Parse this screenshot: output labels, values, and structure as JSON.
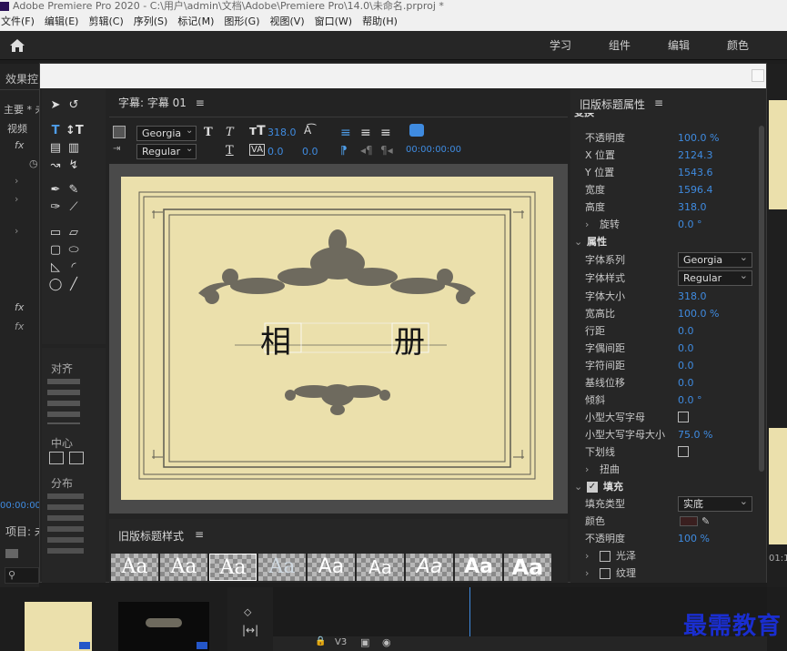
{
  "window_title": "Adobe Premiere Pro 2020 - C:\\用户\\admin\\文档\\Adobe\\Premiere Pro\\14.0\\未命名.prproj *",
  "menu": [
    "文件(F)",
    "编辑(E)",
    "剪辑(C)",
    "序列(S)",
    "标记(M)",
    "图形(G)",
    "视图(V)",
    "窗口(W)",
    "帮助(H)"
  ],
  "workspaces": [
    "学习",
    "组件",
    "编辑",
    "颜色"
  ],
  "left_panel": {
    "tab": "效果控",
    "main": "主要 * 未",
    "video": "视频",
    "project_tab": "项目: 未",
    "timecode": "00:00:00:0"
  },
  "dialog": {
    "title_tab": "字幕: 字幕 01",
    "toolbar": {
      "font": "Georgia",
      "style": "Regular",
      "font_size": "318.0",
      "leading": "0.0",
      "kerning": "0.0",
      "tracking": "0.0",
      "timecode": "00:00:00:00"
    },
    "tools_align_label": "对齐",
    "tools_center_label": "中心",
    "tools_distribute_label": "分布",
    "canvas_text_left": "相",
    "canvas_text_right": "册",
    "styles_title": "旧版标题样式",
    "style_swatch_text": "Aa"
  },
  "props": {
    "title": "旧版标题属性",
    "transform_header": "变换",
    "rows_transform": [
      {
        "label": "不透明度",
        "value": "100.0 %"
      },
      {
        "label": "X 位置",
        "value": "2124.3"
      },
      {
        "label": "Y 位置",
        "value": "1543.6"
      },
      {
        "label": "宽度",
        "value": "1596.4"
      },
      {
        "label": "高度",
        "value": "318.0"
      },
      {
        "label": "旋转",
        "value": "0.0 °"
      }
    ],
    "attributes_header": "属性",
    "font_family_label": "字体系列",
    "font_family_value": "Georgia",
    "font_style_label": "字体样式",
    "font_style_value": "Regular",
    "rows_attrs": [
      {
        "label": "字体大小",
        "value": "318.0"
      },
      {
        "label": "宽高比",
        "value": "100.0 %"
      },
      {
        "label": "行距",
        "value": "0.0"
      },
      {
        "label": "字偶间距",
        "value": "0.0"
      },
      {
        "label": "字符间距",
        "value": "0.0"
      },
      {
        "label": "基线位移",
        "value": "0.0"
      },
      {
        "label": "倾斜",
        "value": "0.0 °"
      }
    ],
    "smallcaps_label": "小型大写字母",
    "smallcaps_size_label": "小型大写字母大小",
    "smallcaps_size_value": "75.0 %",
    "underline_label": "下划线",
    "distort_label": "扭曲",
    "fill_header": "填充",
    "fill_type_label": "填充类型",
    "fill_type_value": "实底",
    "color_label": "颜色",
    "opacity2_label": "不透明度",
    "opacity2_value": "100 %",
    "sheen_label": "光泽",
    "texture_label": "纹理"
  },
  "timeline": {
    "track": "V3",
    "ruler_tail": "01:1"
  },
  "watermark": "最需教育",
  "colors": {
    "accent": "#3f8be0",
    "canvas": "#ebe0ac",
    "ornament": "#6e6a5e",
    "fill_color": "#3a1f1f"
  }
}
